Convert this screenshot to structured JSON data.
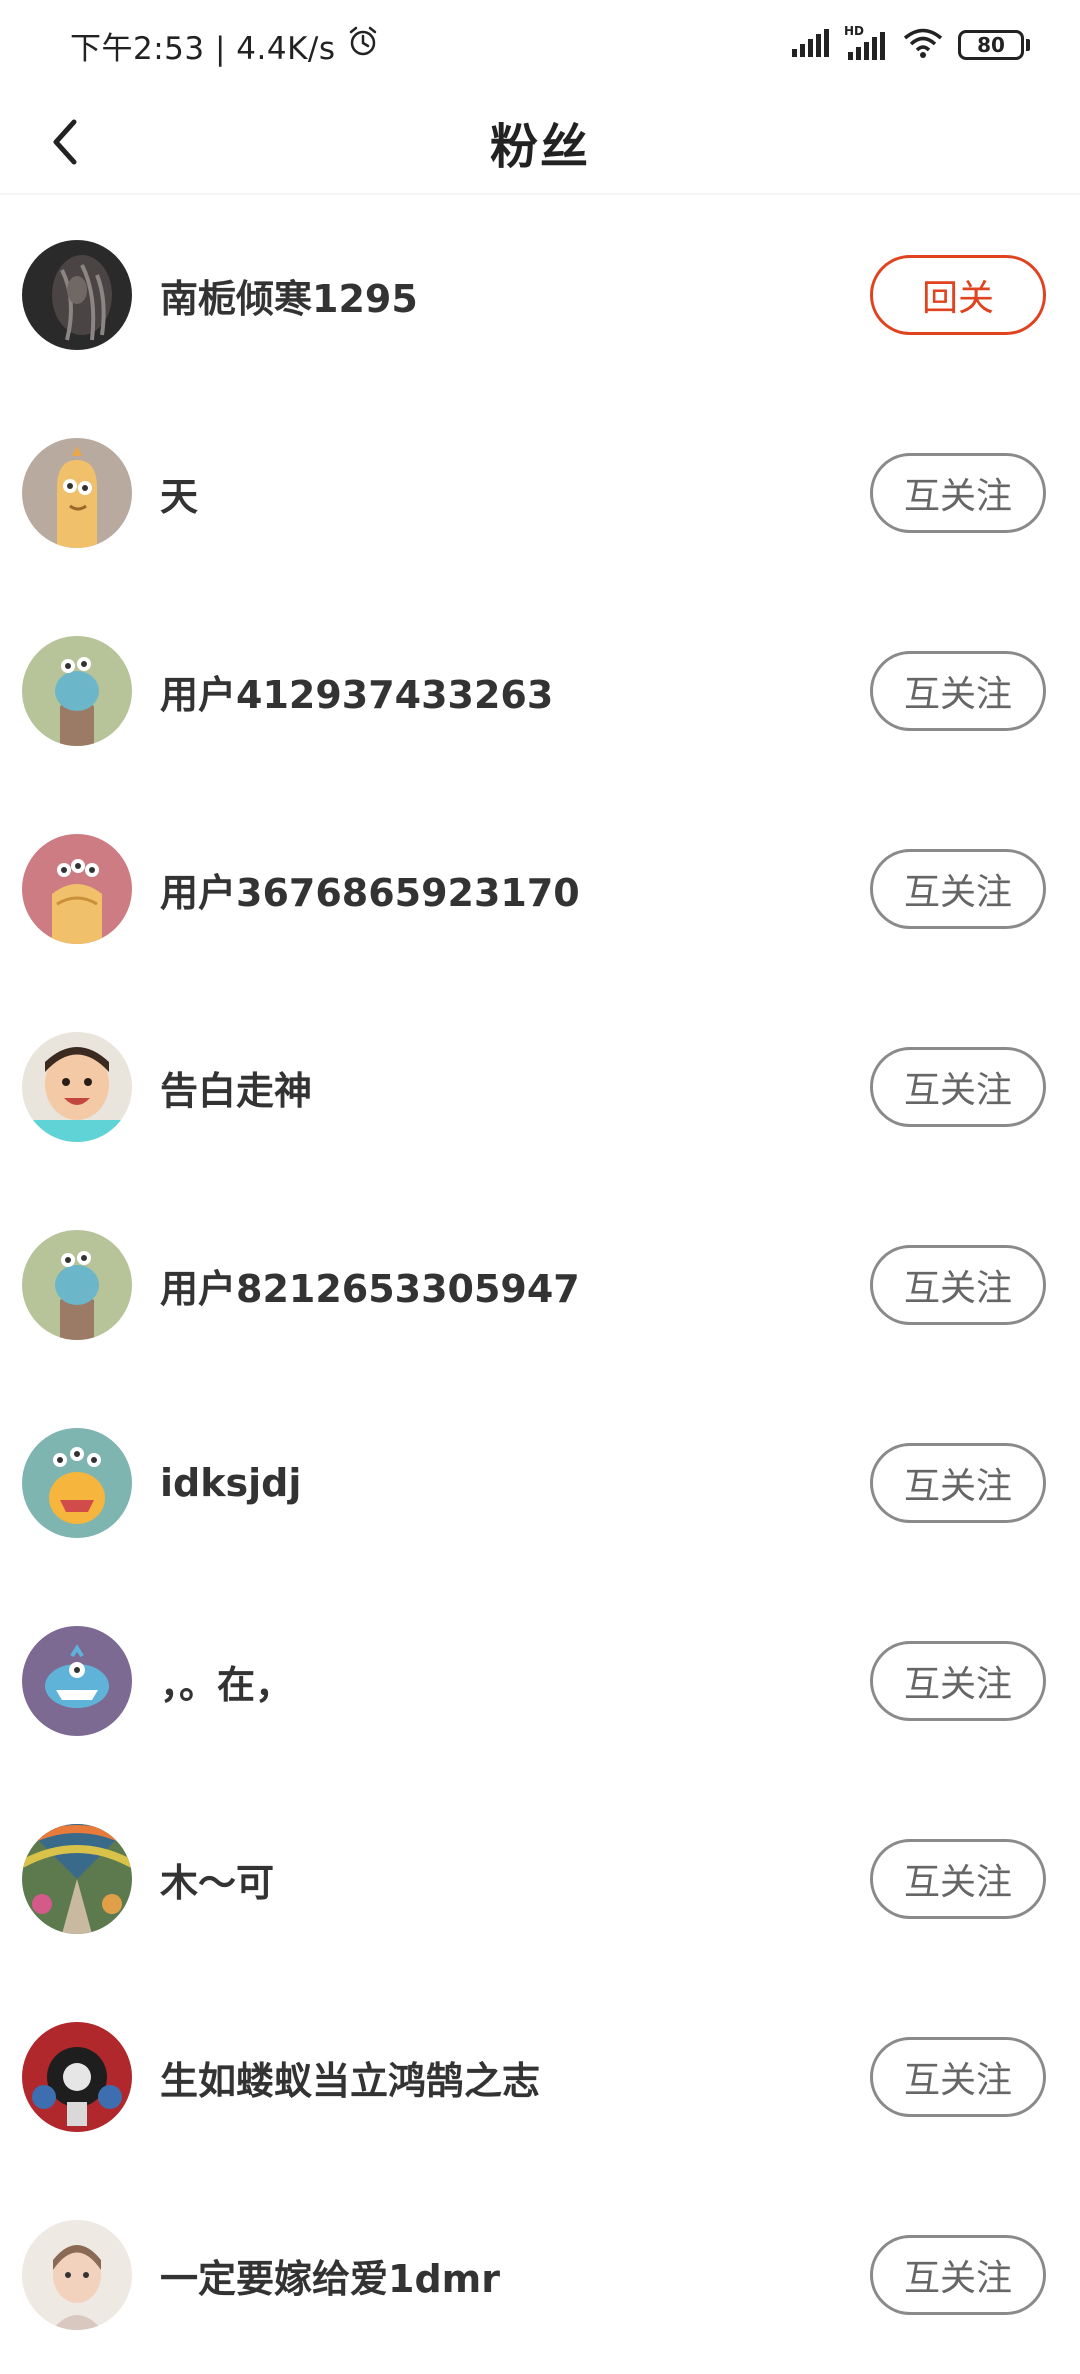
{
  "status_bar": {
    "time_speed": "下午2:53 | 4.4K/s",
    "battery": "80",
    "hd_label": "HD"
  },
  "header": {
    "title": "粉丝"
  },
  "fans": [
    {
      "name": "南栀倾寒1295",
      "button": "回关"
    },
    {
      "name": "天",
      "button": "互关注"
    },
    {
      "name": "用户412937433263",
      "button": "互关注"
    },
    {
      "name": "用户3676865923170",
      "button": "互关注"
    },
    {
      "name": "告白走神",
      "button": "互关注"
    },
    {
      "name": "用户8212653305947",
      "button": "互关注"
    },
    {
      "name": "idksjdj",
      "button": "互关注"
    },
    {
      "name": "，。在，",
      "button": "互关注"
    },
    {
      "name": "木〜可",
      "button": "互关注"
    },
    {
      "name": "生如蝼蚁当立鸿鹄之志",
      "button": "互关注"
    },
    {
      "name": "一定要嫁给爱1dmr",
      "button": "互关注"
    }
  ],
  "colors": {
    "accent": "#e0431f",
    "button_border": "#8a8a8a"
  }
}
